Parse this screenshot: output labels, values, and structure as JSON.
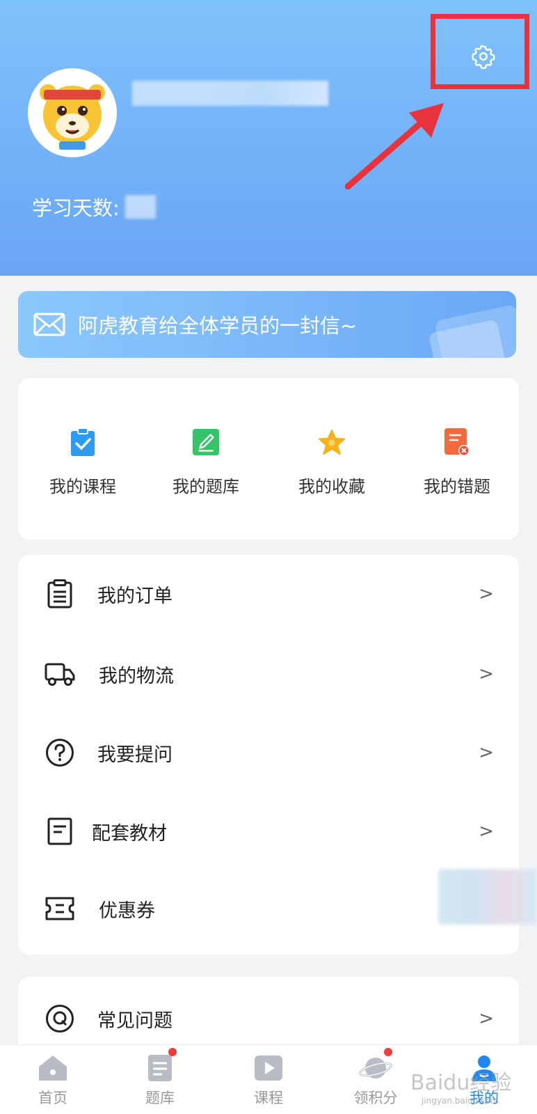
{
  "profile": {
    "study_days_label": "学习天数:"
  },
  "banner": {
    "letter_text": "阿虎教育给全体学员的一封信~"
  },
  "quick": [
    {
      "label": "我的课程",
      "icon": "clipboard-check-icon",
      "color": "#2f9bf0"
    },
    {
      "label": "我的题库",
      "icon": "edit-note-icon",
      "color": "#35c46a"
    },
    {
      "label": "我的收藏",
      "icon": "star-icon",
      "color": "#f6b21c"
    },
    {
      "label": "我的错题",
      "icon": "wrong-doc-icon",
      "color": "#f56a3c"
    }
  ],
  "menu": [
    {
      "label": "我的订单",
      "icon": "order-clipboard-icon",
      "chevron": ">"
    },
    {
      "label": "我的物流",
      "icon": "truck-icon",
      "chevron": ">"
    },
    {
      "label": "我要提问",
      "icon": "question-icon",
      "chevron": ">"
    },
    {
      "label": "配套教材",
      "icon": "book-icon",
      "chevron": ">"
    },
    {
      "label": "优惠券",
      "icon": "coupon-icon",
      "chevron": ""
    }
  ],
  "faq": {
    "label": "常见问题",
    "icon": "q-circle-icon",
    "chevron": ">"
  },
  "tabs": [
    {
      "label": "首页",
      "icon": "home-icon",
      "badge": false
    },
    {
      "label": "题库",
      "icon": "doc-icon",
      "badge": true
    },
    {
      "label": "课程",
      "icon": "play-icon",
      "badge": false
    },
    {
      "label": "领积分",
      "icon": "planet-icon",
      "badge": true
    },
    {
      "label": "我的",
      "icon": "user-icon",
      "badge": false,
      "active": true
    }
  ],
  "watermark": {
    "text": "Baidu经验",
    "sub": "jingyan.baidu.com"
  },
  "colors": {
    "header": "#7ab8f8",
    "accent": "#1e88f0",
    "highlight": "#e8323c"
  }
}
